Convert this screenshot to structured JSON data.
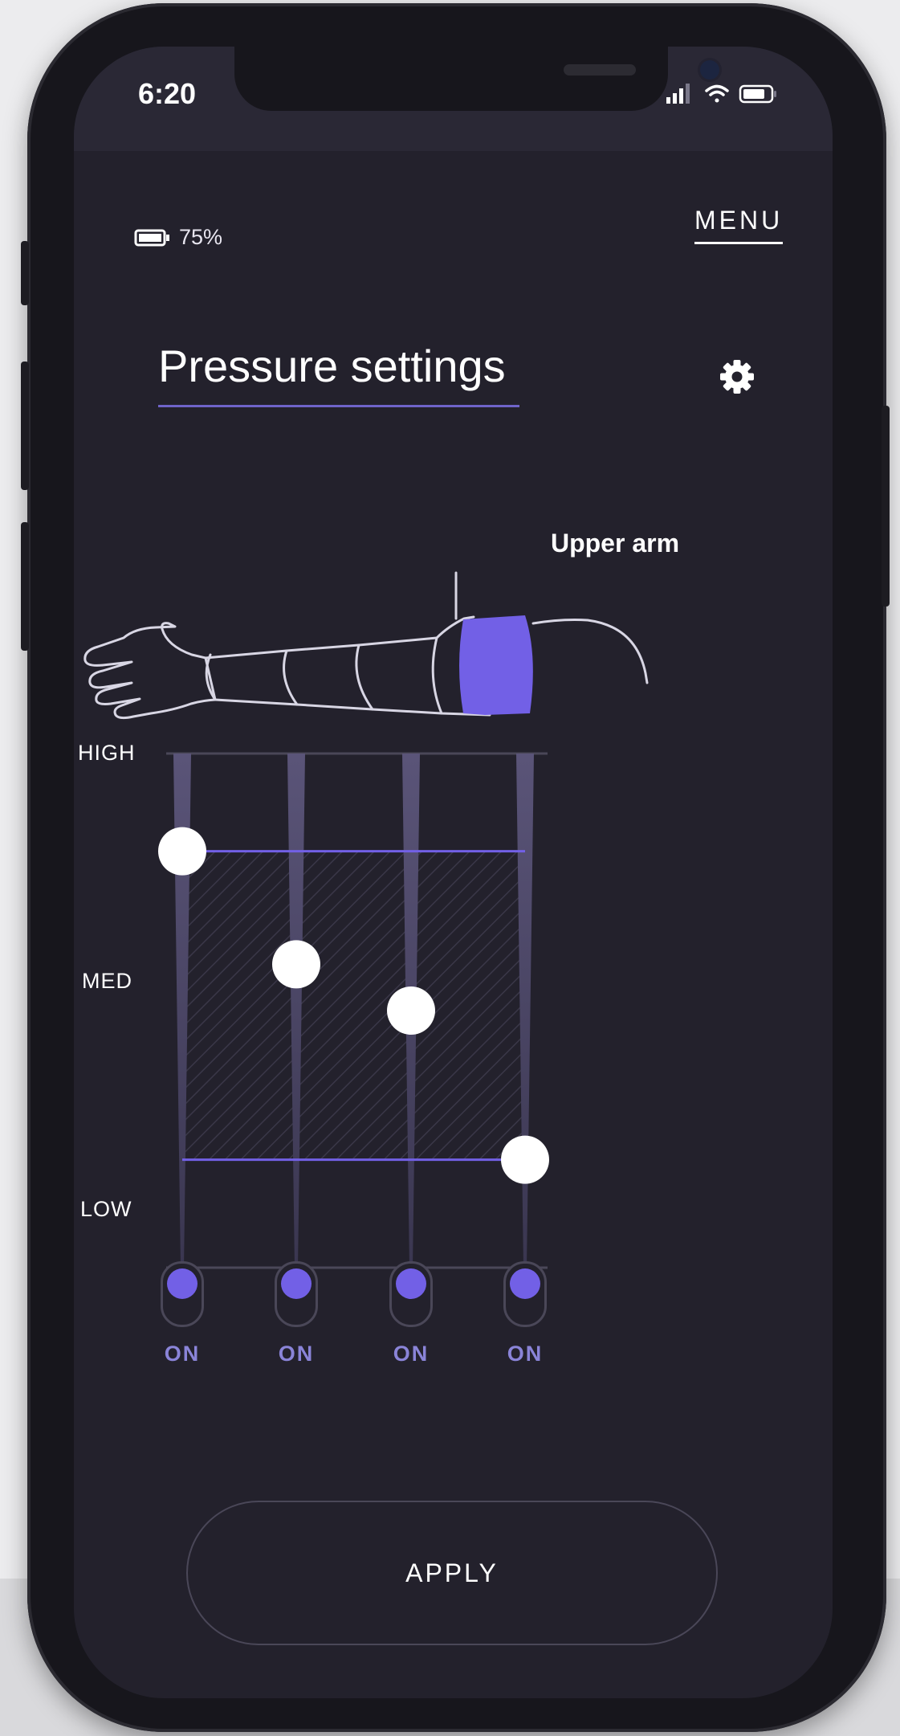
{
  "status_bar": {
    "time": "6:20",
    "icons": [
      "signal-icon",
      "wifi-icon",
      "battery-icon"
    ]
  },
  "header": {
    "battery_percent": "75%",
    "menu_label": "MENU"
  },
  "page": {
    "title": "Pressure settings",
    "settings_icon": "gear-icon"
  },
  "arm": {
    "selected_zone_label": "Upper arm",
    "accent": "#7260e6"
  },
  "pressure_scale": {
    "high_label": "HIGH",
    "med_label": "MED",
    "low_label": "LOW"
  },
  "zones": [
    {
      "level": 0.81,
      "toggle_label": "ON",
      "enabled": true
    },
    {
      "level": 0.59,
      "toggle_label": "ON",
      "enabled": true
    },
    {
      "level": 0.5,
      "toggle_label": "ON",
      "enabled": true
    },
    {
      "level": 0.21,
      "toggle_label": "ON",
      "enabled": true
    }
  ],
  "apply_label": "APPLY",
  "colors": {
    "background": "#23212c",
    "accent": "#7260e6",
    "track": "#5a5478",
    "knob": "#ffffff"
  }
}
